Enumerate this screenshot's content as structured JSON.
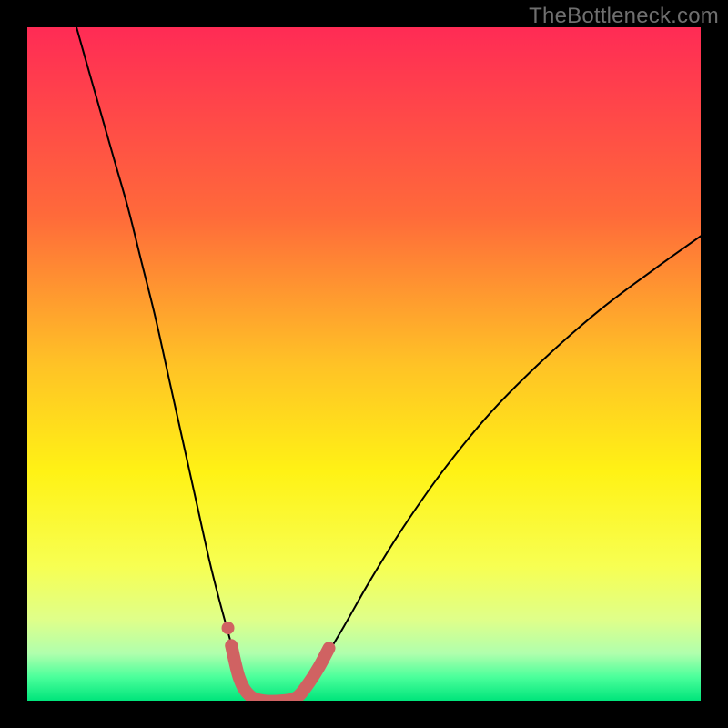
{
  "watermark": "TheBottleneck.com",
  "chart_data": {
    "type": "line",
    "title": "",
    "xlabel": "",
    "ylabel": "",
    "xlim": [
      0,
      1
    ],
    "ylim": [
      0,
      1
    ],
    "grid": false,
    "legend": false,
    "background_gradient": {
      "stops": [
        {
          "offset": 0.0,
          "color": "#ff2b55"
        },
        {
          "offset": 0.28,
          "color": "#ff6a3a"
        },
        {
          "offset": 0.5,
          "color": "#ffc226"
        },
        {
          "offset": 0.66,
          "color": "#fff215"
        },
        {
          "offset": 0.8,
          "color": "#f7ff52"
        },
        {
          "offset": 0.88,
          "color": "#dfff8a"
        },
        {
          "offset": 0.93,
          "color": "#b0ffad"
        },
        {
          "offset": 0.965,
          "color": "#4bff9b"
        },
        {
          "offset": 1.0,
          "color": "#00e57b"
        }
      ]
    },
    "series": [
      {
        "name": "left-curve",
        "color": "#000000",
        "width": 2,
        "points": [
          {
            "x": 0.073,
            "y": 1.0
          },
          {
            "x": 0.09,
            "y": 0.94
          },
          {
            "x": 0.11,
            "y": 0.87
          },
          {
            "x": 0.13,
            "y": 0.8
          },
          {
            "x": 0.15,
            "y": 0.73
          },
          {
            "x": 0.17,
            "y": 0.65
          },
          {
            "x": 0.19,
            "y": 0.57
          },
          {
            "x": 0.21,
            "y": 0.48
          },
          {
            "x": 0.23,
            "y": 0.39
          },
          {
            "x": 0.25,
            "y": 0.3
          },
          {
            "x": 0.27,
            "y": 0.21
          },
          {
            "x": 0.285,
            "y": 0.15
          },
          {
            "x": 0.3,
            "y": 0.095
          },
          {
            "x": 0.31,
            "y": 0.058
          },
          {
            "x": 0.32,
            "y": 0.028
          },
          {
            "x": 0.33,
            "y": 0.01
          },
          {
            "x": 0.34,
            "y": 0.0
          }
        ]
      },
      {
        "name": "right-curve",
        "color": "#000000",
        "width": 2,
        "points": [
          {
            "x": 0.4,
            "y": 0.0
          },
          {
            "x": 0.415,
            "y": 0.02
          },
          {
            "x": 0.44,
            "y": 0.06
          },
          {
            "x": 0.47,
            "y": 0.11
          },
          {
            "x": 0.51,
            "y": 0.18
          },
          {
            "x": 0.56,
            "y": 0.26
          },
          {
            "x": 0.62,
            "y": 0.345
          },
          {
            "x": 0.69,
            "y": 0.43
          },
          {
            "x": 0.77,
            "y": 0.51
          },
          {
            "x": 0.85,
            "y": 0.58
          },
          {
            "x": 0.93,
            "y": 0.64
          },
          {
            "x": 1.0,
            "y": 0.69
          }
        ]
      },
      {
        "name": "highlight-band",
        "color": "#d06262",
        "width": 14,
        "points": [
          {
            "x": 0.303,
            "y": 0.082
          },
          {
            "x": 0.315,
            "y": 0.033
          },
          {
            "x": 0.33,
            "y": 0.008
          },
          {
            "x": 0.35,
            "y": 0.0
          },
          {
            "x": 0.38,
            "y": 0.0
          },
          {
            "x": 0.4,
            "y": 0.005
          },
          {
            "x": 0.415,
            "y": 0.022
          },
          {
            "x": 0.432,
            "y": 0.048
          },
          {
            "x": 0.448,
            "y": 0.078
          }
        ]
      }
    ],
    "markers": [
      {
        "x": 0.298,
        "y": 0.108,
        "r": 7,
        "color": "#d06262"
      }
    ]
  }
}
